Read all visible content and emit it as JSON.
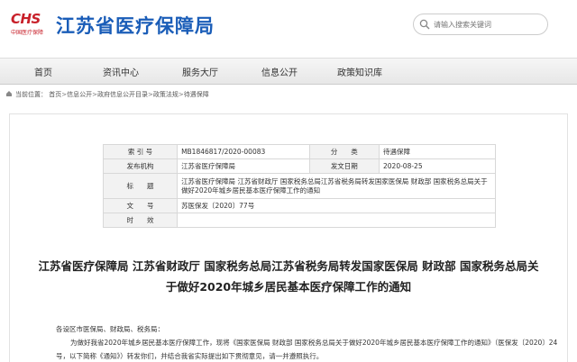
{
  "header": {
    "logo_text": "CHS",
    "logo_subtitle": "中国医疗保障",
    "site_title": "江苏省医疗保障局",
    "search_placeholder": "请输入搜索关键词"
  },
  "nav": {
    "items": [
      "首页",
      "资讯中心",
      "服务大厅",
      "信息公开",
      "政策知识库"
    ]
  },
  "breadcrumb": {
    "label": "当前位置：",
    "items": [
      "首页",
      "信息公开",
      "政府信息公开目录",
      "政策法规",
      "待遇保障"
    ],
    "separator": ">"
  },
  "meta": {
    "index_label": "索 引 号",
    "index_value": "MB1846817/2020-00083",
    "category_label": "分　　类",
    "category_value": "待遇保障",
    "publisher_label": "发布机构",
    "publisher_value": "江苏省医疗保障局",
    "date_label": "发文日期",
    "date_value": "2020-08-25",
    "title_label": "标　　题",
    "title_value": "江苏省医疗保障局 江苏省财政厅 国家税务总局江苏省税务局转发国家医保局 财政部 国家税务总局关于做好2020年城乡居民基本医疗保障工作的通知",
    "docno_label": "文　　号",
    "docno_value": "苏医保发〔2020〕77号",
    "status_label": "时　　效",
    "status_value": ""
  },
  "article": {
    "title": "江苏省医疗保障局 江苏省财政厅 国家税务总局江苏省税务局转发国家医保局 财政部 国家税务总局关于做好2020年城乡居民基本医疗保障工作的通知",
    "salutation": "各设区市医保局、财政局、税务局：",
    "para1": "为做好我省2020年城乡居民基本医疗保障工作，现将《国家医保局 财政部 国家税务总局关于做好2020年城乡居民基本医疗保障工作的通知》（医保发〔2020〕24号，以下简称《通知》）转发你们，并结合我省实际提出如下贯彻意见，请一并遵照执行。"
  }
}
